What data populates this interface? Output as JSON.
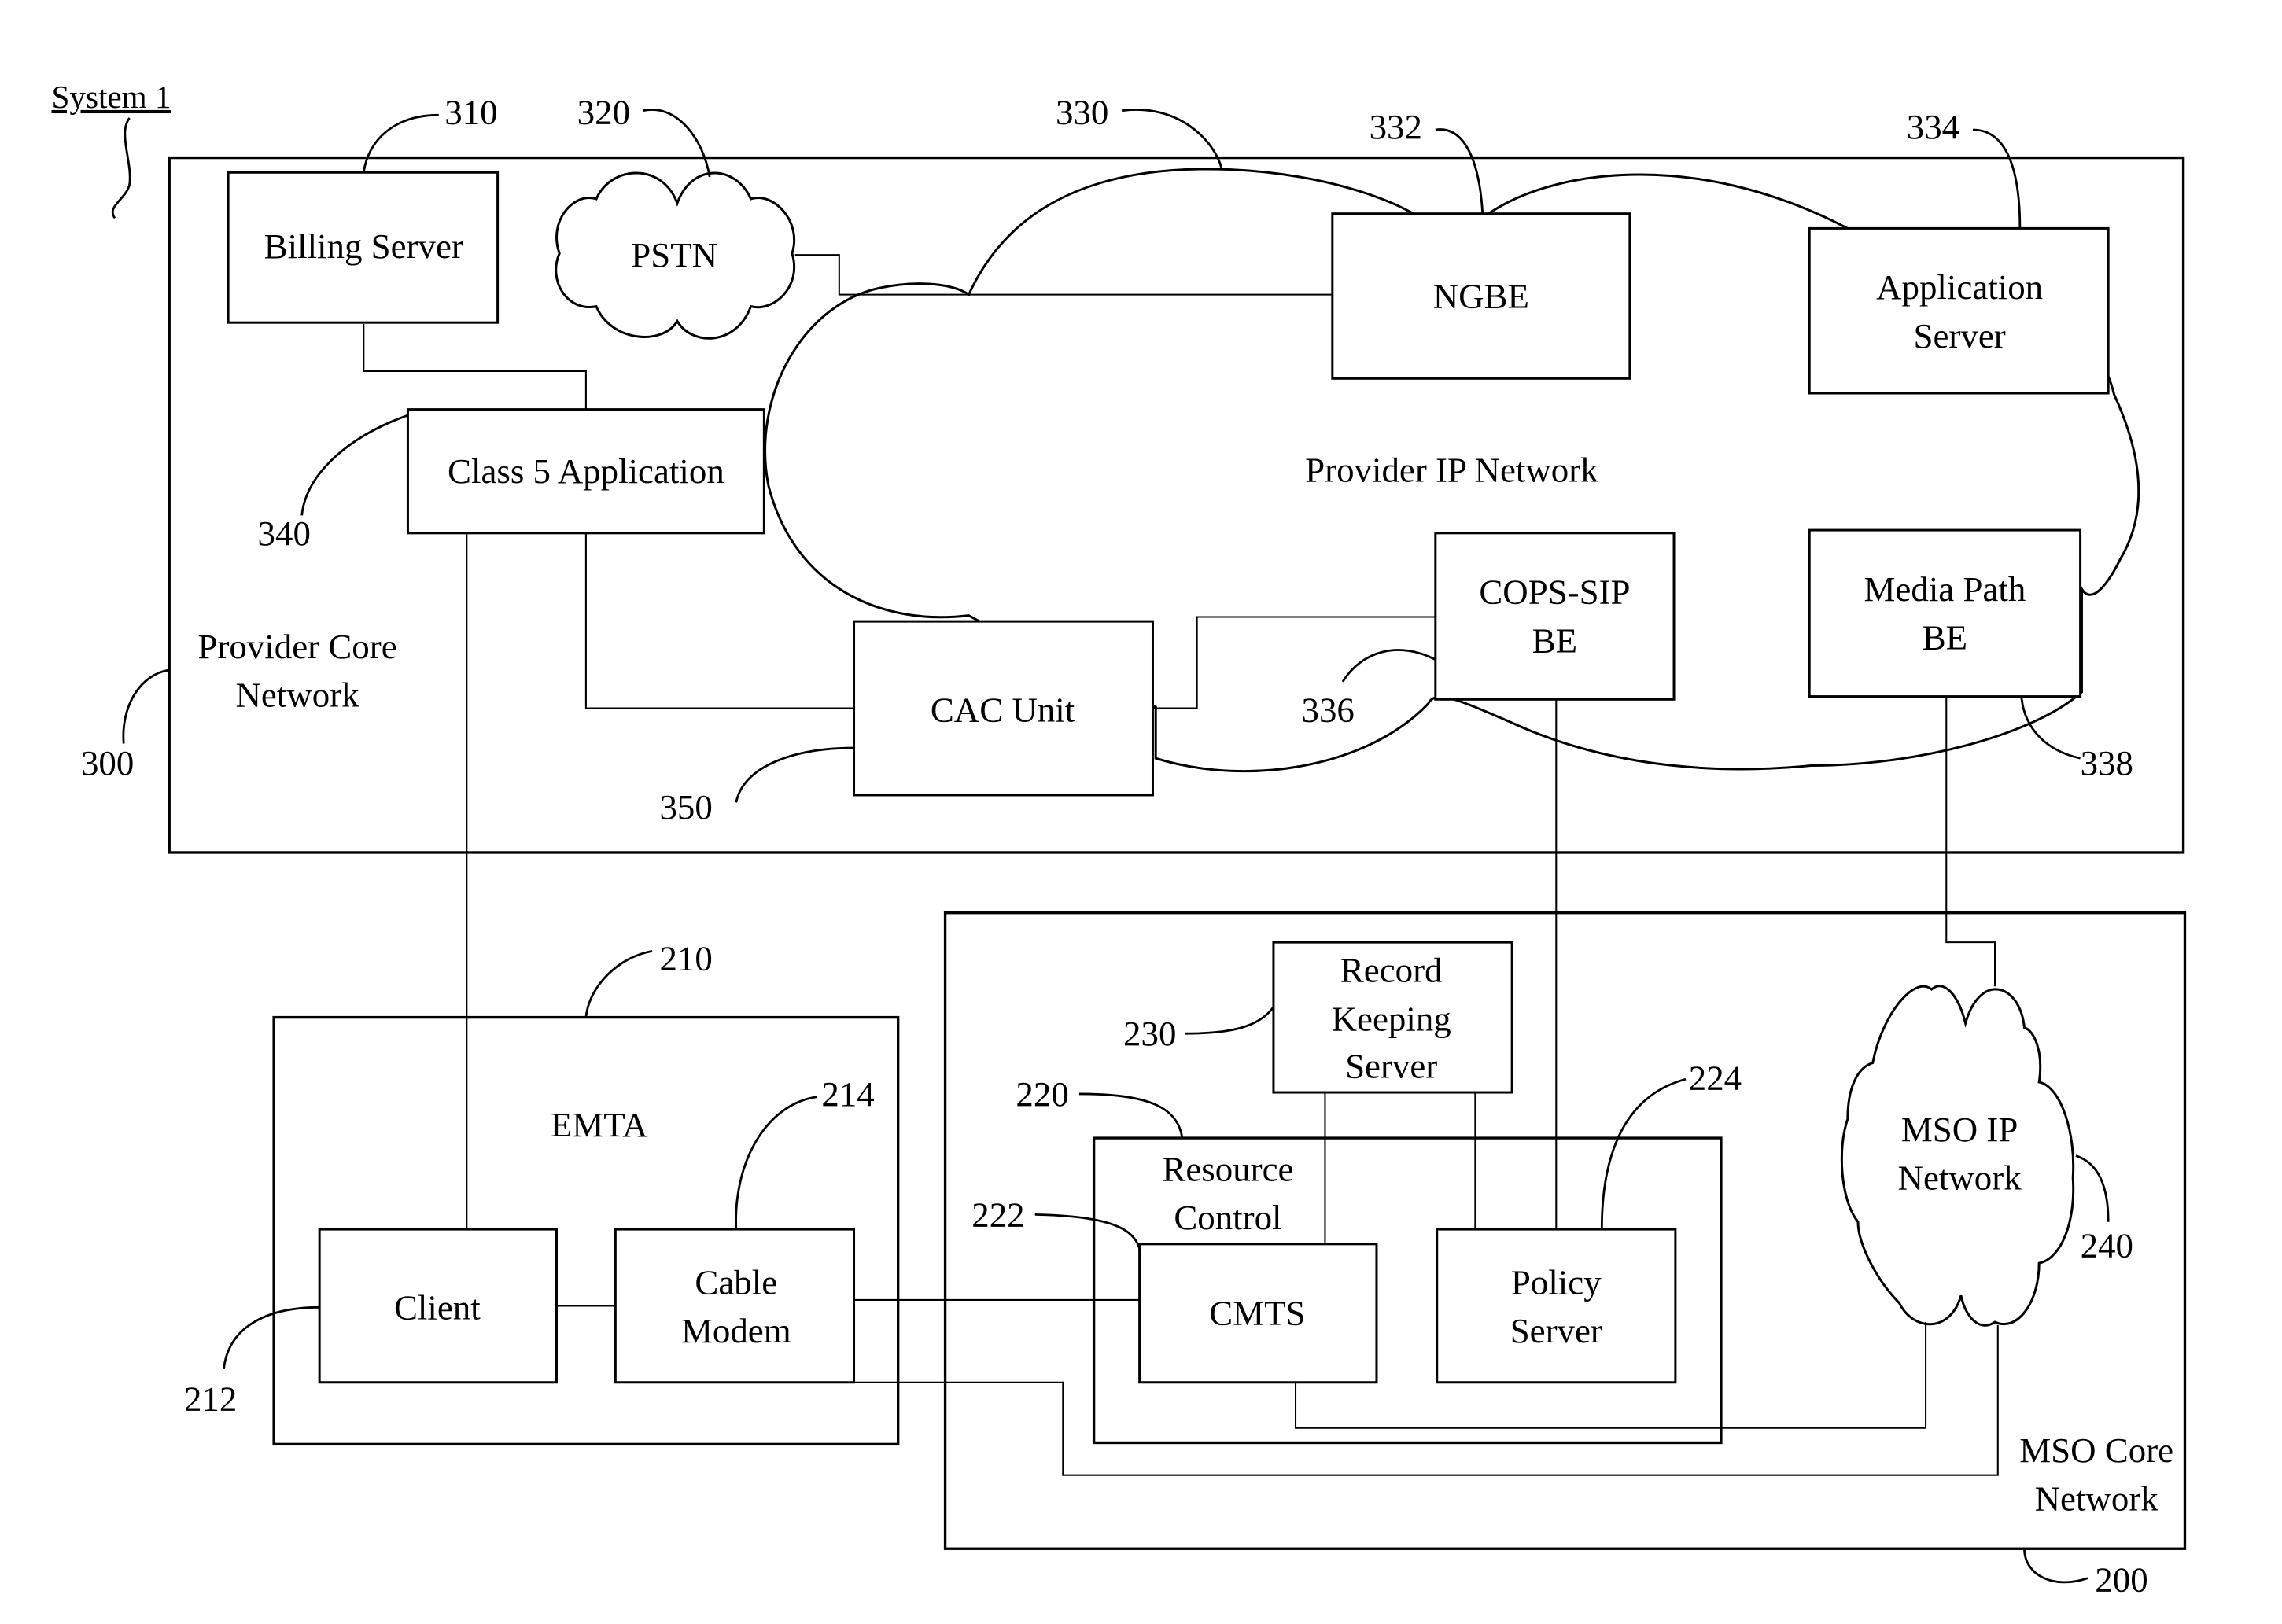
{
  "title": "System 1",
  "provider_core": {
    "label_lines": [
      "Provider Core",
      "Network"
    ],
    "ref": "300",
    "billing_server": {
      "label": "Billing Server",
      "ref": "310"
    },
    "pstn": {
      "label": "PSTN",
      "ref": "320"
    },
    "provider_ip_network": {
      "label": "Provider IP Network",
      "ref": "330"
    },
    "ngbe": {
      "label": "NGBE",
      "ref": "332"
    },
    "application_server": {
      "label_lines": [
        "Application",
        "Server"
      ],
      "ref": "334"
    },
    "cops_sip_be": {
      "label_lines": [
        "COPS-SIP",
        "BE"
      ],
      "ref": "336"
    },
    "media_path_be": {
      "label_lines": [
        "Media Path",
        "BE"
      ],
      "ref": "338"
    },
    "class5_application": {
      "label": "Class 5 Application",
      "ref": "340"
    },
    "cac_unit": {
      "label": "CAC Unit",
      "ref": "350"
    }
  },
  "emta": {
    "label": "EMTA",
    "ref": "210",
    "client": {
      "label": "Client",
      "ref": "212"
    },
    "cable_modem": {
      "label_lines": [
        "Cable",
        "Modem"
      ],
      "ref": "214"
    }
  },
  "mso_core": {
    "label_lines": [
      "MSO Core",
      "Network"
    ],
    "ref": "200",
    "resource_control": {
      "label_lines": [
        "Resource",
        "Control"
      ],
      "ref": "220"
    },
    "cmts": {
      "label": "CMTS",
      "ref": "222"
    },
    "policy_server": {
      "label_lines": [
        "Policy",
        "Server"
      ],
      "ref": "224"
    },
    "record_keeping_server": {
      "label_lines": [
        "Record",
        "Keeping",
        "Server"
      ],
      "ref": "230"
    },
    "mso_ip_network": {
      "label_lines": [
        "MSO IP",
        "Network"
      ],
      "ref": "240"
    }
  }
}
